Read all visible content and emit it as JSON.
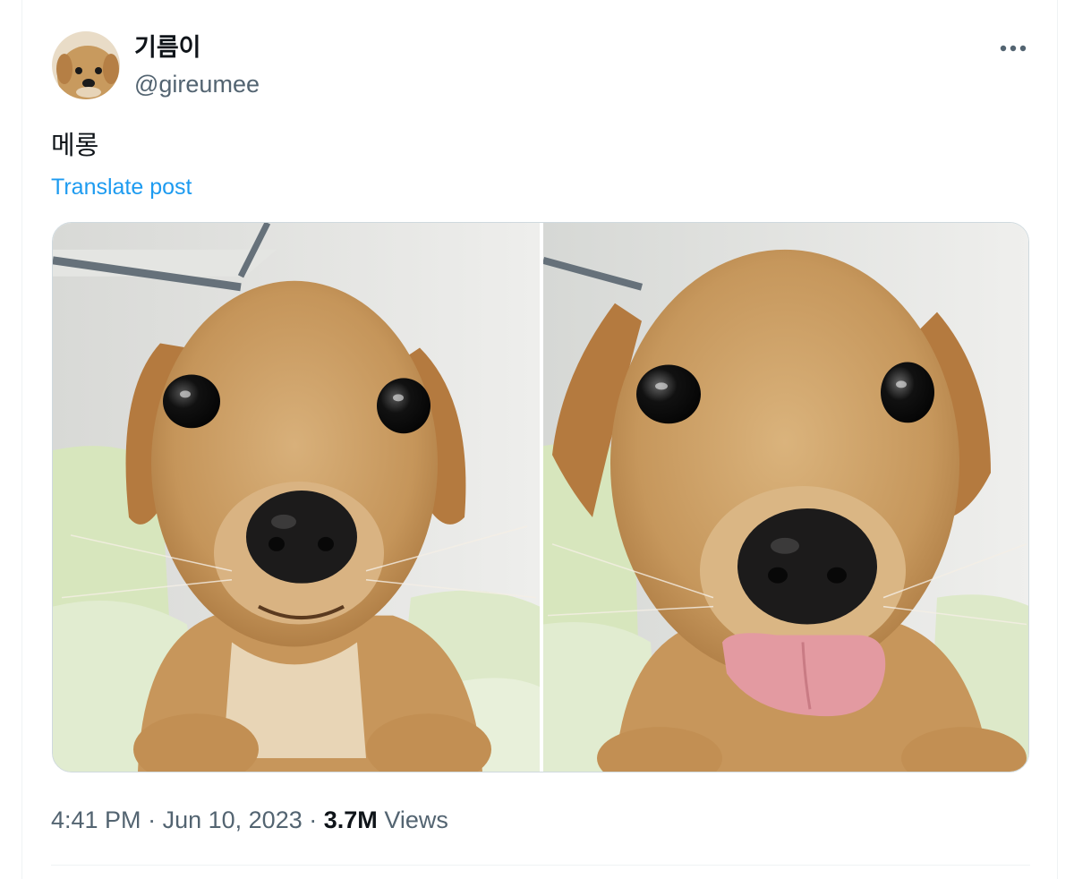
{
  "post": {
    "display_name": "기름이",
    "handle": "@gireumee",
    "text": "메롱",
    "translate_label": "Translate post",
    "time": "4:41 PM",
    "separator": "·",
    "date": "Jun 10, 2023",
    "views_count": "3.7M",
    "views_label": "Views"
  },
  "media": {
    "photos": [
      {
        "subject": "puppy-face",
        "tongue_out": false
      },
      {
        "subject": "puppy-tongue-out",
        "tongue_out": true
      }
    ]
  },
  "colors": {
    "link": "#1d9bf0",
    "secondary_text": "#536471",
    "primary_text": "#0f1419",
    "border": "#cfd9de"
  },
  "icons": {
    "more": "more-horizontal-icon"
  }
}
